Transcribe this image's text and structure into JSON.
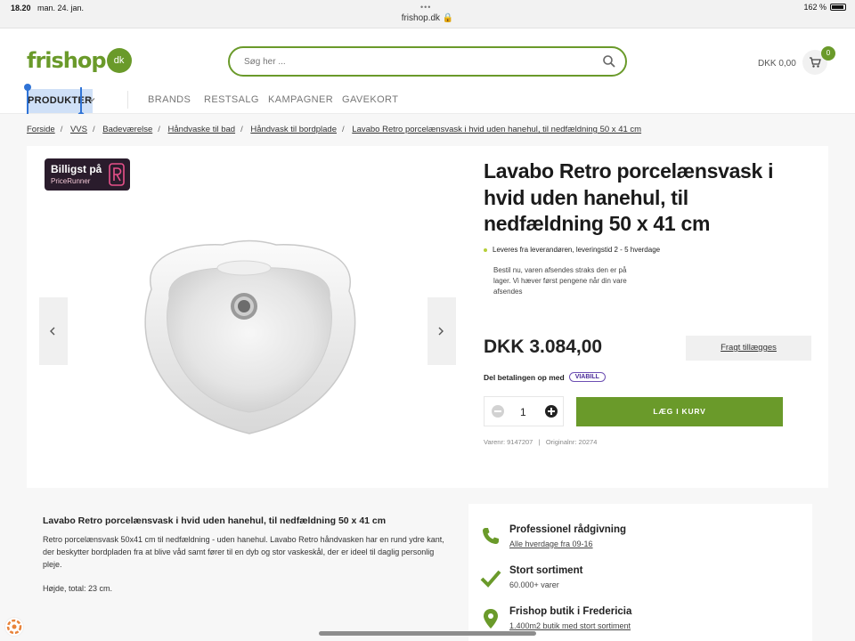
{
  "status_bar": {
    "time": "18.20",
    "date": "man. 24. jan.",
    "dots": "•••",
    "url": "frishop.dk",
    "battery": "162 %"
  },
  "header": {
    "logo_text": "frishop",
    "logo_badge": "dk",
    "search_placeholder": "Søg her ...",
    "cart_total": "DKK 0,00",
    "cart_count": "0",
    "brand_color": "#6a9a2a"
  },
  "nav": {
    "items": [
      "PRODUKTER",
      "BRANDS",
      "RESTSALG",
      "KAMPAGNER",
      "GAVEKORT"
    ]
  },
  "breadcrumb": [
    "Forside",
    "VVS",
    "Badeværelse",
    "Håndvaske til bad",
    "Håndvask til bordplade",
    "Lavabo Retro porcelænsvask i hvid uden hanehul, til nedfældning 50 x 41 cm"
  ],
  "badge": {
    "line1": "Billigst på",
    "line2": "PriceRunner"
  },
  "product": {
    "title": "Lavabo Retro porcelænsvask i hvid uden hanehul, til nedfældning 50 x 41 cm",
    "delivery": "Leveres fra leverandøren, leveringstid 2 - 5 hverdage",
    "delivery_note": "Bestil nu, varen afsendes straks den er på lager. Vi hæver først pengene når din vare afsendes",
    "price": "DKK 3.084,00",
    "freight_label": "Fragt tillægges",
    "split_payment": "Del betalingen op med",
    "viabill": "VIABILL",
    "quantity": "1",
    "add_to_cart": "LÆG I KURV",
    "sku_label": "Varenr:",
    "sku": "9147207",
    "sku_sep": "|",
    "original_label": "Originalnr:",
    "original": "20274"
  },
  "description": {
    "title": "Lavabo Retro porcelænsvask i hvid uden hanehul, til nedfældning 50 x 41 cm",
    "body": "Retro porcelænsvask 50x41 cm til nedfældning - uden hanehul. Lavabo Retro håndvasken har en rund ydre kant, der beskytter bordpladen fra at blive våd samt fører til en dyb og stor vaskeskål, der er ideel til daglig personlig pleje.",
    "height": "Højde, total: 23 cm."
  },
  "usps": [
    {
      "icon": "phone-icon",
      "title": "Professionel rådgivning",
      "sub": "Alle hverdage fra 09-16"
    },
    {
      "icon": "check-icon",
      "title": "Stort sortiment",
      "sub": "60.000+ varer"
    },
    {
      "icon": "location-pin-icon",
      "title": "Frishop butik i Fredericia",
      "sub": "1.400m2 butik med stort sortiment"
    }
  ]
}
